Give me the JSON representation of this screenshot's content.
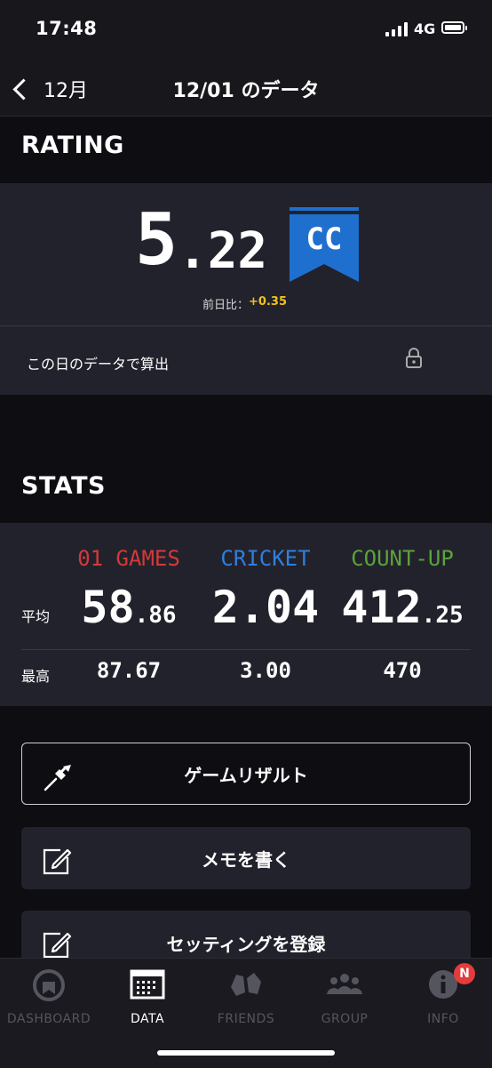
{
  "status_bar": {
    "time": "17:48",
    "network": "4G"
  },
  "nav": {
    "back_label": "12月",
    "title": "12/01 のデータ"
  },
  "rating": {
    "section_title": "RATING",
    "value_int": "5",
    "value_dec": ".22",
    "badge": "CC",
    "diff_label": "前日比：",
    "diff_value": "+0.35",
    "calc_label": "この日のデータで算出",
    "colors": {
      "badge": "#1f6fcf",
      "diff": "#f2c21b"
    }
  },
  "stats": {
    "section_title": "STATS",
    "row_avg_label": "平均",
    "row_max_label": "最高",
    "columns": [
      {
        "name": "01 GAMES",
        "color": "#d33a3a",
        "avg_int": "58",
        "avg_dec": ".86",
        "max": "87.67"
      },
      {
        "name": "CRICKET",
        "color": "#2f7fdf",
        "avg_int": "2.04",
        "avg_dec": "",
        "max": "3.00"
      },
      {
        "name": "COUNT-UP",
        "color": "#5aa33a",
        "avg_int": "412",
        "avg_dec": ".25",
        "max": "470"
      }
    ]
  },
  "actions": {
    "game_result": "ゲームリザルト",
    "write_memo": "メモを書く",
    "register_setting": "セッティングを登録"
  },
  "tabbar": {
    "tabs": [
      {
        "label": "DASHBOARD",
        "icon": "dashboard-icon"
      },
      {
        "label": "DATA",
        "icon": "calendar-icon"
      },
      {
        "label": "FRIENDS",
        "icon": "friends-icon"
      },
      {
        "label": "GROUP",
        "icon": "group-icon"
      },
      {
        "label": "INFO",
        "icon": "info-icon"
      }
    ],
    "active": "DATA",
    "info_badge": "N"
  }
}
